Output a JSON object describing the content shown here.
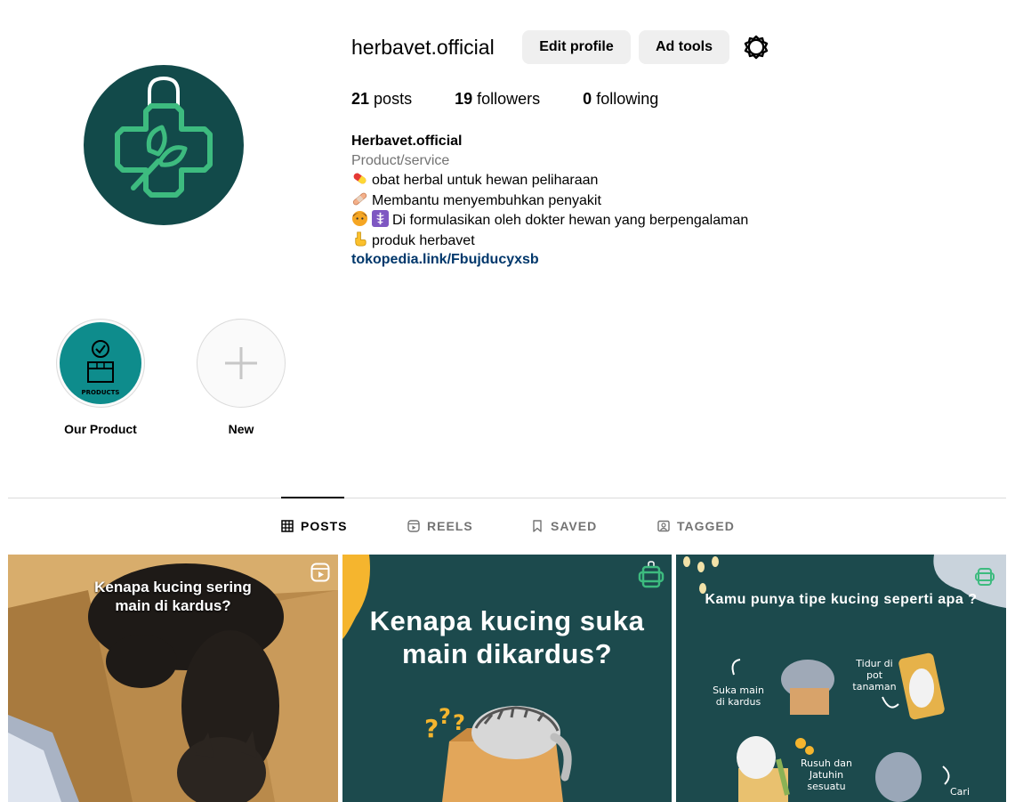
{
  "profile": {
    "username": "herbavet.official",
    "edit_profile_label": "Edit profile",
    "ad_tools_label": "Ad tools"
  },
  "stats": {
    "posts_count": "21",
    "posts_label": "posts",
    "followers_count": "19",
    "followers_label": "followers",
    "following_count": "0",
    "following_label": "following"
  },
  "bio": {
    "name": "Herbavet.official",
    "category": "Product/service",
    "lines": [
      "obat herbal untuk hewan peliharaan",
      "Membantu menyembuhkan penyakit",
      "Di formulasikan oleh dokter hewan yang berpengalaman",
      "produk herbavet"
    ],
    "link": "tokopedia.link/Fbujducyxsb"
  },
  "highlights": [
    {
      "label": "Our Product",
      "cover_text": "PRODUCTS"
    },
    {
      "label": "New"
    }
  ],
  "tabs": [
    {
      "label": "POSTS",
      "active": true
    },
    {
      "label": "REELS",
      "active": false
    },
    {
      "label": "SAVED",
      "active": false
    },
    {
      "label": "TAGGED",
      "active": false
    }
  ],
  "posts": [
    {
      "caption": "Kenapa kucing sering main di kardus?",
      "type": "reel"
    },
    {
      "caption": "Kenapa kucing suka main dikardus?"
    },
    {
      "caption": "Kamu punya tipe kucing seperti apa ?",
      "labels": [
        "Suka main di kardus",
        "Tidur di pot tanaman",
        "Rusuh dan Jatuhin sesuatu",
        "Cari"
      ]
    }
  ],
  "colors": {
    "brand_teal": "#124a4a",
    "brand_green": "#3dbb7f",
    "link_blue": "#00376b",
    "button_bg": "#efefef",
    "post_bg": "#1c4a4d",
    "accent_yellow": "#f5b52e"
  }
}
